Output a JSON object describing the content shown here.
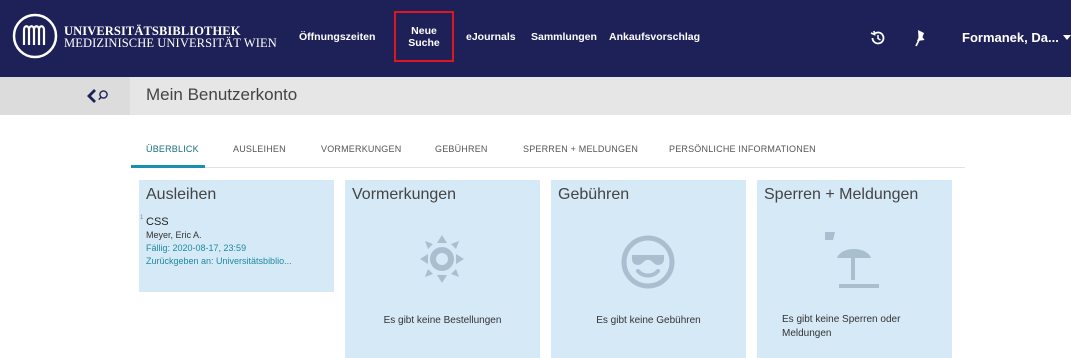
{
  "header": {
    "brand_line1": "UNIVERSITÄTSBIBLIOTHEK",
    "brand_line2": "MEDIZINISCHE UNIVERSITÄT WIEN",
    "nav": {
      "opening_hours": "Öffnungszeiten",
      "new_search_line1": "Neue",
      "new_search_line2": "Suche",
      "ejournals": "eJournals",
      "collections": "Sammlungen",
      "purchase_suggestion": "Ankaufsvorschlag"
    },
    "user_name": "Formanek, Da..."
  },
  "subheader": {
    "title": "Mein Benutzerkonto"
  },
  "tabs": [
    "ÜBERBLICK",
    "AUSLEIHEN",
    "VORMERKUNGEN",
    "GEBÜHREN",
    "SPERREN + MELDUNGEN",
    "PERSÖNLICHE INFORMATIONEN"
  ],
  "tiles": {
    "loans": {
      "title": "Ausleihen",
      "item": {
        "index": "1",
        "title": "CSS",
        "author": "Meyer, Eric A.",
        "due": "Fällig: 2020-08-17, 23:59",
        "return_to": "Zurückgeben an: Universitätsbiblio..."
      }
    },
    "reservations": {
      "title": "Vormerkungen",
      "empty": "Es gibt keine Bestellungen"
    },
    "fees": {
      "title": "Gebühren",
      "empty": "Es gibt keine Gebühren"
    },
    "blocks": {
      "title": "Sperren + Meldungen",
      "empty_line1": "Es gibt keine Sperren oder",
      "empty_line2": "Meldungen"
    }
  },
  "colors": {
    "header_bg": "#1e2158",
    "accent": "#1b8fb0",
    "tile_bg": "#d6e9f6",
    "highlight_border": "#e0161f"
  },
  "icons": [
    "university-logo",
    "history-icon",
    "pin-icon",
    "chevron-down-icon",
    "back-icon",
    "search-icon",
    "sun-icon",
    "smiley-sunglasses-icon",
    "beach-umbrella-icon"
  ]
}
